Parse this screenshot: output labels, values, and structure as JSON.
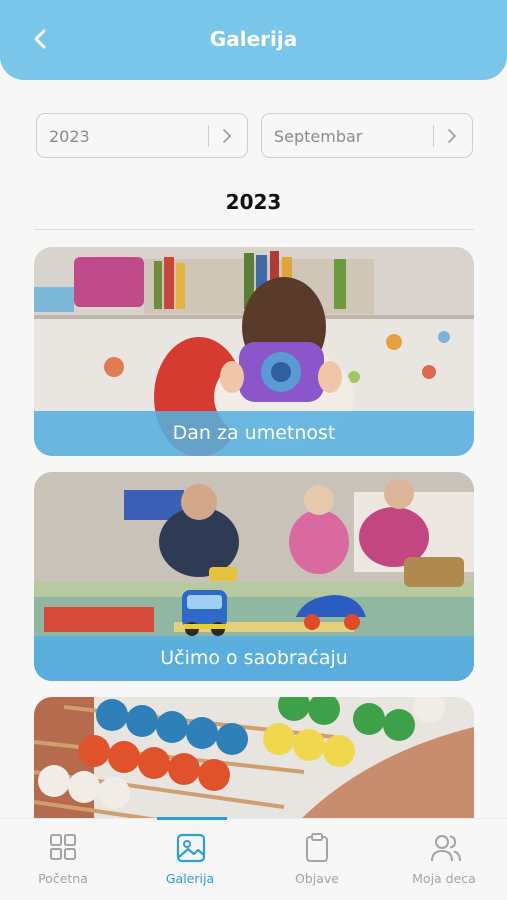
{
  "header": {
    "title": "Galerija"
  },
  "filters": {
    "year": "2023",
    "month": "Septembar"
  },
  "section": {
    "year_heading": "2023"
  },
  "albums": [
    {
      "caption": "Dan za umetnost"
    },
    {
      "caption": "Učimo o saobraćaju"
    },
    {
      "caption": ""
    }
  ],
  "tabs": [
    {
      "label": "Početna",
      "icon": "grid-icon",
      "active": false
    },
    {
      "label": "Galerija",
      "icon": "image-icon",
      "active": true
    },
    {
      "label": "Objave",
      "icon": "clipboard-icon",
      "active": false
    },
    {
      "label": "Moja deca",
      "icon": "users-icon",
      "active": false
    }
  ],
  "colors": {
    "header": "#79c6ea",
    "accent": "#2a9fd8",
    "caption_bg": "#56afe0"
  }
}
